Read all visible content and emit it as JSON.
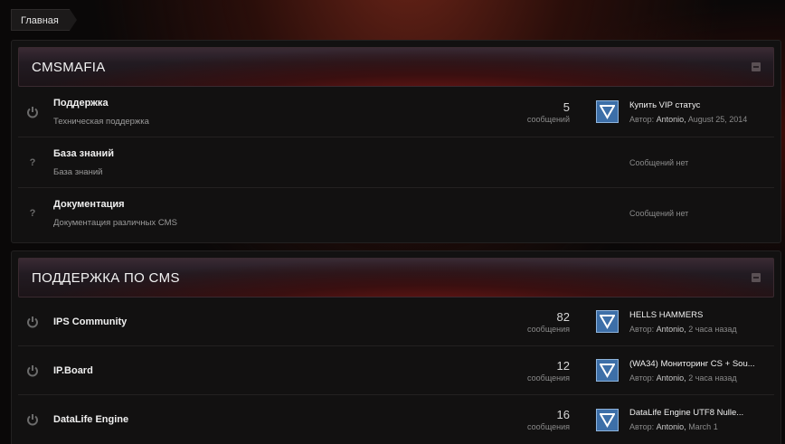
{
  "breadcrumb": {
    "home": "Главная"
  },
  "categories": [
    {
      "title": "CMSMAFIA",
      "forums": [
        {
          "icon": "power-icon",
          "name": "Поддержка",
          "desc": "Техническая поддержка",
          "count": "5",
          "count_label": "сообщений",
          "lp_title": "Купить VIP статус",
          "lp_author_label": "Автор:",
          "lp_author": "Antonio,",
          "lp_time": "August 25, 2014"
        },
        {
          "icon": "question-icon",
          "name": "База знаний",
          "desc": "База знаний",
          "no_posts": "Сообщений нет"
        },
        {
          "icon": "question-icon",
          "name": "Документация",
          "desc": "Документация различных CMS",
          "no_posts": "Сообщений нет"
        }
      ]
    },
    {
      "title": "ПОДДЕРЖКА ПО CMS",
      "forums": [
        {
          "icon": "power-icon",
          "name": "IPS Community",
          "desc": "",
          "count": "82",
          "count_label": "сообщения",
          "lp_title": "HELLS HAMMERS",
          "lp_author_label": "Автор:",
          "lp_author": "Antonio,",
          "lp_time": "2 часа назад"
        },
        {
          "icon": "power-icon",
          "name": "IP.Board",
          "desc": "",
          "count": "12",
          "count_label": "сообщения",
          "lp_title": "(WA34) Мониторинг CS + Sou...",
          "lp_author_label": "Автор:",
          "lp_author": "Antonio,",
          "lp_time": "2 часа назад"
        },
        {
          "icon": "power-icon",
          "name": "DataLife Engine",
          "desc": "",
          "count": "16",
          "count_label": "сообщения",
          "lp_title": "DataLife Engine UTF8 Nulle...",
          "lp_author_label": "Автор:",
          "lp_author": "Antonio,",
          "lp_time": "March 1"
        }
      ]
    }
  ]
}
